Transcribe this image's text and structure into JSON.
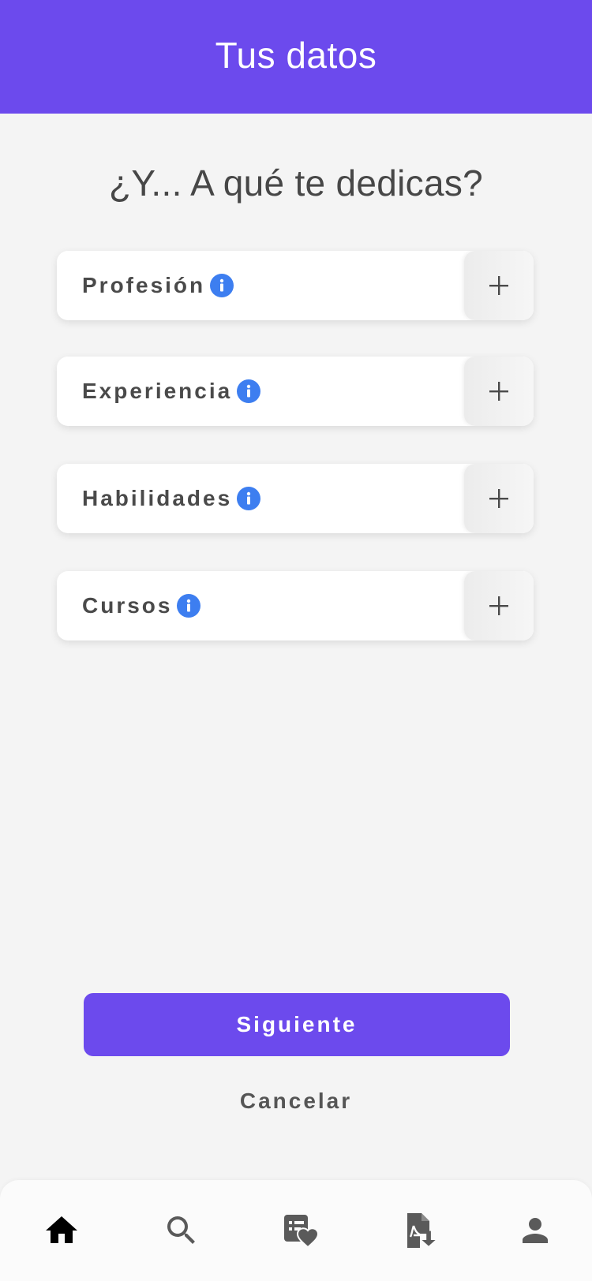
{
  "header": {
    "title": "Tus datos"
  },
  "main": {
    "question": "¿Y... A qué te dedicas?",
    "fields": [
      {
        "label": "Profesión",
        "info_icon": "info-icon",
        "add_icon": "plus-icon"
      },
      {
        "label": "Experiencia",
        "info_icon": "info-icon",
        "add_icon": "plus-icon"
      },
      {
        "label": "Habilidades",
        "info_icon": "info-icon",
        "add_icon": "plus-icon"
      },
      {
        "label": "Cursos",
        "info_icon": "info-icon",
        "add_icon": "plus-icon"
      }
    ]
  },
  "actions": {
    "primary_label": "Siguiente",
    "secondary_label": "Cancelar"
  },
  "bottom_nav": {
    "items": [
      {
        "icon": "home-icon",
        "active": true
      },
      {
        "icon": "search-icon",
        "active": false
      },
      {
        "icon": "favorites-list-icon",
        "active": false
      },
      {
        "icon": "pdf-download-icon",
        "active": false
      },
      {
        "icon": "profile-icon",
        "active": false
      }
    ]
  },
  "colors": {
    "brand": "#6c4aed",
    "info": "#3d7ef0",
    "background": "#f4f4f4",
    "text": "#474747",
    "nav_active": "#000000",
    "nav_inactive": "#5a5a5a"
  }
}
